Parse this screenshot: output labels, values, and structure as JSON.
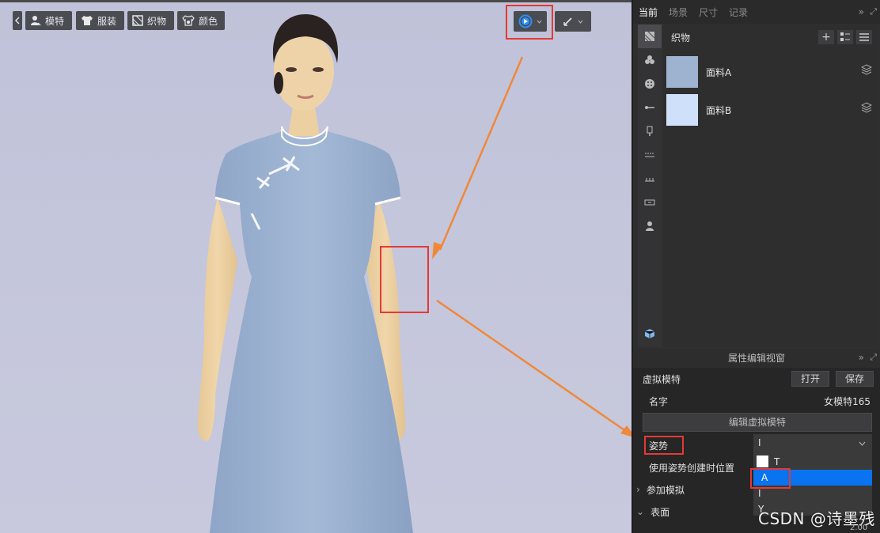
{
  "viewport": {
    "toolbar": {
      "back_icon": "chevron-left-icon",
      "avatar_label": "模特",
      "garment_label": "服装",
      "fabric_label": "织物",
      "color_label": "颜色"
    },
    "sim_button_icon": "play-circle-icon",
    "pen_button_icon": "pen-icon"
  },
  "right_panel": {
    "tabs": [
      "当前",
      "场景",
      "尺寸",
      "记录"
    ],
    "library_title": "织物",
    "fabrics": [
      {
        "name": "面料A",
        "color": "#9db3cf"
      },
      {
        "name": "面料B",
        "color": "#cfe0fb"
      }
    ]
  },
  "property_editor": {
    "title": "属性编辑视窗",
    "section": "虚拟模特",
    "open_label": "打开",
    "save_label": "保存",
    "name_label": "名字",
    "name_value": "女模特165",
    "edit_avatar_label": "编辑虚拟模特",
    "pose_label": "姿势",
    "pose_value": "I",
    "use_pose_label": "使用姿势创建时位置",
    "participate_label": "参加模拟",
    "surface_label": "表面",
    "pose_options": [
      "T",
      "A",
      "I",
      "Y"
    ],
    "selected_option": "A",
    "bottom_value": "2.00"
  },
  "watermark": "CSDN @诗墨残",
  "colors": {
    "accent_blue": "#0a73f0",
    "highlight_red": "#e53935",
    "arrow_orange": "#f0883a"
  }
}
